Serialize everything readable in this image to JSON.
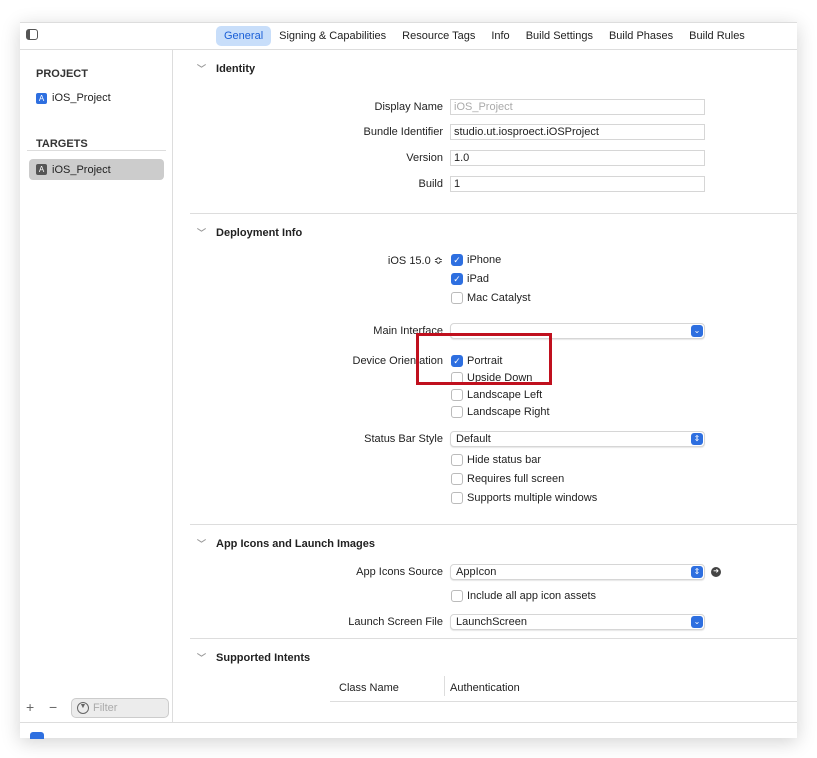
{
  "tabs": [
    "General",
    "Signing & Capabilities",
    "Resource Tags",
    "Info",
    "Build Settings",
    "Build Phases",
    "Build Rules"
  ],
  "sidebar": {
    "project_header": "PROJECT",
    "project_item": "iOS_Project",
    "targets_header": "TARGETS",
    "target_item": "iOS_Project",
    "filter_placeholder": "Filter",
    "add": "+",
    "remove": "−"
  },
  "identity": {
    "title": "Identity",
    "display_name_label": "Display Name",
    "display_name_placeholder": "iOS_Project",
    "bundle_label": "Bundle Identifier",
    "bundle_value": "studio.ut.iosproect.iOSProject",
    "version_label": "Version",
    "version_value": "1.0",
    "build_label": "Build",
    "build_value": "1"
  },
  "deployment": {
    "title": "Deployment Info",
    "ios_version": "iOS 15.0 ≎",
    "devices": [
      {
        "label": "iPhone",
        "checked": true
      },
      {
        "label": "iPad",
        "checked": true
      },
      {
        "label": "Mac Catalyst",
        "checked": false
      }
    ],
    "main_interface_label": "Main Interface",
    "main_interface_value": "",
    "orientation_label": "Device Orientation",
    "orientations": [
      {
        "label": "Portrait",
        "checked": true
      },
      {
        "label": "Upside Down",
        "checked": false
      },
      {
        "label": "Landscape Left",
        "checked": false
      },
      {
        "label": "Landscape Right",
        "checked": false
      }
    ],
    "status_bar_label": "Status Bar Style",
    "status_bar_value": "Default",
    "options": [
      {
        "label": "Hide status bar",
        "checked": false
      },
      {
        "label": "Requires full screen",
        "checked": false
      },
      {
        "label": "Supports multiple windows",
        "checked": false
      }
    ]
  },
  "app_icons": {
    "title": "App Icons and Launch Images",
    "source_label": "App Icons Source",
    "source_value": "AppIcon",
    "include_label": "Include all app icon assets",
    "launch_label": "Launch Screen File",
    "launch_value": "LaunchScreen"
  },
  "intents": {
    "title": "Supported Intents",
    "col1": "Class Name",
    "col2": "Authentication"
  },
  "colors": {
    "accent": "#2e6fe0",
    "highlight": "#c0101e"
  }
}
